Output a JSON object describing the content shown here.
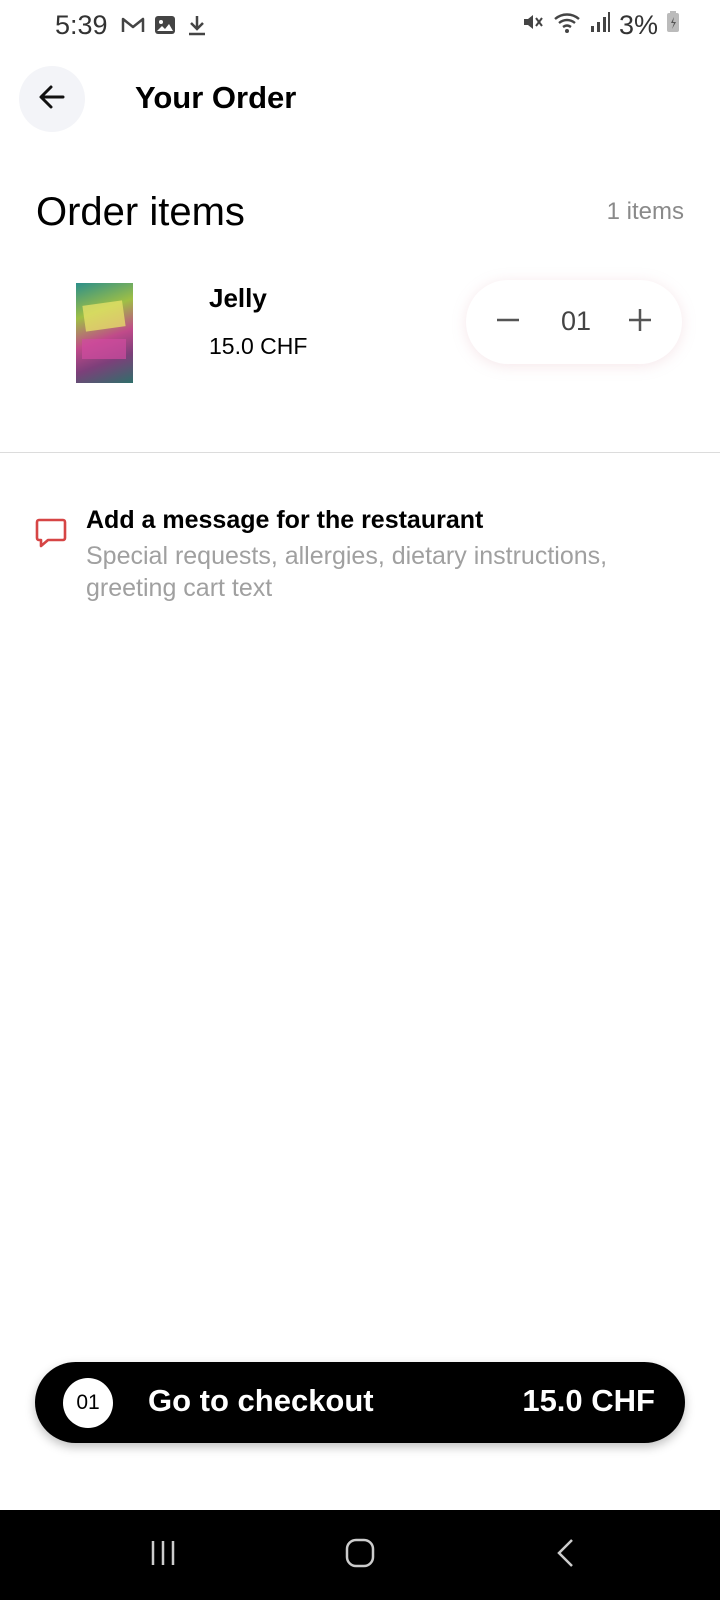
{
  "status_bar": {
    "time": "5:39",
    "battery": "3%",
    "left_icons": [
      "gmail-icon",
      "gallery-icon",
      "download-icon"
    ],
    "right_icons": [
      "mute-icon",
      "wifi-icon",
      "signal-icon",
      "battery-icon"
    ]
  },
  "header": {
    "title": "Your Order",
    "back_icon": "arrow-left-icon"
  },
  "order": {
    "section_title": "Order items",
    "items_count": "1 items",
    "items": [
      {
        "name": "Jelly",
        "price": "15.0 CHF",
        "quantity": "01"
      }
    ]
  },
  "message": {
    "title": "Add a message for the restaurant",
    "subtitle": "Special requests, allergies, dietary instructions, greeting cart text",
    "icon": "chat-bubble-icon",
    "accent_color": "#d64545"
  },
  "checkout": {
    "count": "01",
    "label": "Go to checkout",
    "total": "15.0 CHF"
  },
  "nav_bar": {
    "icons": [
      "recent-apps-icon",
      "home-icon",
      "back-icon"
    ]
  }
}
